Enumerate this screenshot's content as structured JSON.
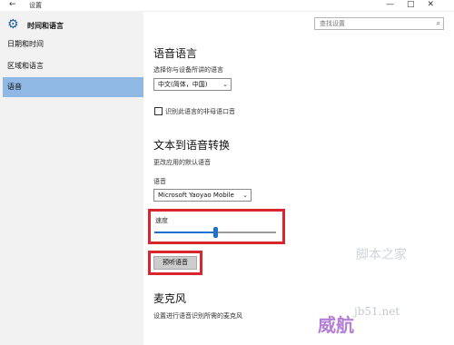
{
  "window": {
    "app_title": "设置",
    "back_icon": "back-arrow-icon",
    "controls": [
      "—",
      "□",
      "✕"
    ]
  },
  "sidebar": {
    "title": "时间和语言",
    "icon": "gear-icon",
    "items": [
      {
        "label": "日期和时间",
        "active": false
      },
      {
        "label": "区域和语言",
        "active": false
      },
      {
        "label": "语音",
        "active": true
      }
    ]
  },
  "search": {
    "placeholder": "查找设置",
    "icon": "search-icon"
  },
  "speech_language": {
    "heading": "语音语言",
    "description": "选择你与设备所讲的语言",
    "selected": "中文(简体，中国)",
    "checkbox_label": "识别此语言的非母语口音",
    "checkbox_checked": false
  },
  "tts": {
    "heading": "文本到语音转换",
    "description": "更改应用的默认语音",
    "voice_label": "语音",
    "voice_selected": "Microsoft Yaoyao Mobile",
    "speed_label": "速度",
    "speed_value": 0.5,
    "preview_button": "预听语音"
  },
  "microphone": {
    "heading": "麦克风",
    "description": "设置进行语音识别所需的麦克风"
  },
  "watermark": {
    "site": "jb51.net",
    "brand": "脚本之家",
    "overlay": "威航"
  },
  "colors": {
    "accent": "#1e6fd0",
    "highlight_box": "#d9262c",
    "active_nav": "#8fb8e4",
    "sidebar_bg": "#f2f2f2"
  }
}
